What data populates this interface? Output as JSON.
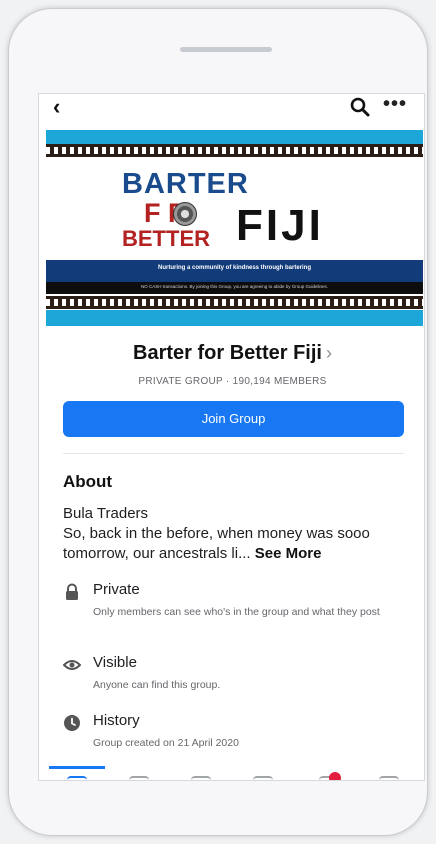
{
  "banner": {
    "title_line1": "BARTER",
    "title_for": "F  R",
    "title_better": "BETTER",
    "title_fiji": "FIJI",
    "tagline": "Nurturing a community of kindness through bartering",
    "disclaimer": "NO CASH transactions. By joining this Group, you are agreeing to abide by Group Guidelines."
  },
  "header": {
    "back_icon": "‹",
    "more_icon": "•••"
  },
  "group": {
    "name": "Barter for Better Fiji",
    "meta": "PRIVATE GROUP · 190,194 MEMBERS",
    "join_label": "Join Group"
  },
  "about": {
    "heading": "About",
    "line1": "Bula Traders",
    "body": "So, back in the before, when money was sooo tomorrow, our ancestrals li... ",
    "see_more": "See More"
  },
  "info": [
    {
      "icon": "lock-icon",
      "title": "Private",
      "desc": "Only members can see who's in the group and what they post"
    },
    {
      "icon": "eye-icon",
      "title": "Visible",
      "desc": "Anyone can find this group."
    },
    {
      "icon": "clock-icon",
      "title": "History",
      "desc": "Group created on 21 April 2020"
    }
  ],
  "colors": {
    "accent": "#1877f2",
    "banner_blue": "#1da6d8",
    "banner_navy": "#123b7a",
    "badge": "#e41e3f"
  }
}
